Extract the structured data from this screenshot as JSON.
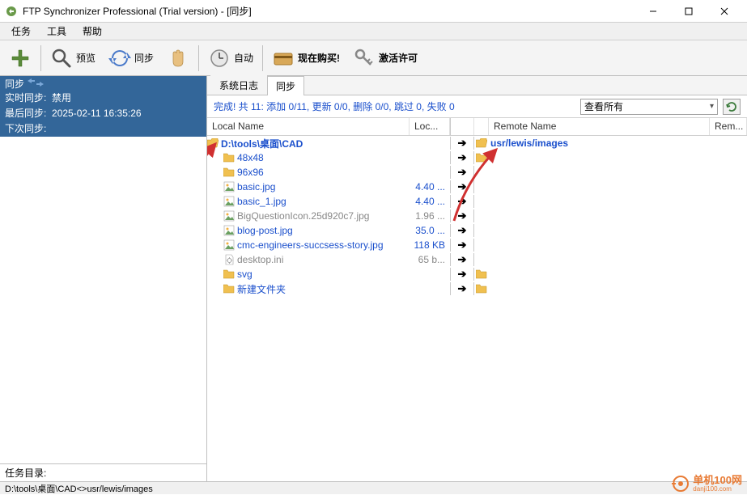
{
  "title": "FTP Synchronizer Professional (Trial version) - [同步]",
  "menu": {
    "task": "任务",
    "tools": "工具",
    "help": "帮助"
  },
  "toolbar": {
    "add": "",
    "preview": "预览",
    "sync": "同步",
    "stop": "",
    "auto": "自动",
    "buy": "现在购买!",
    "license": "激活许可"
  },
  "left": {
    "sync_title": "同步",
    "realtime_label": "实时同步:",
    "realtime_value": "禁用",
    "last_label": "最后同步:",
    "last_value": "2025-02-11 16:35:26",
    "next_label": "下次同步:",
    "next_value": "",
    "task_dir_label": "任务目录:"
  },
  "tabs": {
    "syslog": "系统日志",
    "sync": "同步"
  },
  "status": {
    "text": "完成!  共 11: 添加 0/11, 更新 0/0, 删除 0/0, 跳过 0, 失败 0",
    "filter": "查看所有"
  },
  "columns": {
    "local_name": "Local Name",
    "local_size": "Loc...",
    "remote_name": "Remote Name",
    "remote_size": "Rem..."
  },
  "local_root": "D:\\tools\\桌面\\CAD",
  "remote_root": "usr/lewis/images",
  "files": [
    {
      "name": "48x48",
      "size": "",
      "type": "folder",
      "grey": false,
      "remote_folder": true
    },
    {
      "name": "96x96",
      "size": "",
      "type": "folder",
      "grey": false,
      "remote_folder": false
    },
    {
      "name": "basic.jpg",
      "size": "4.40 ...",
      "type": "jpg",
      "grey": false,
      "remote_folder": false
    },
    {
      "name": "basic_1.jpg",
      "size": "4.40 ...",
      "type": "jpg",
      "grey": false,
      "remote_folder": false
    },
    {
      "name": "BigQuestionIcon.25d920c7.jpg",
      "size": "1.96 ...",
      "type": "jpg",
      "grey": true,
      "remote_folder": false
    },
    {
      "name": "blog-post.jpg",
      "size": "35.0 ...",
      "type": "jpg",
      "grey": false,
      "remote_folder": false
    },
    {
      "name": "cmc-engineers-succsess-story.jpg",
      "size": "118 KB",
      "type": "jpg",
      "grey": false,
      "remote_folder": false
    },
    {
      "name": "desktop.ini",
      "size": "65 b...",
      "type": "ini",
      "grey": true,
      "remote_folder": false
    },
    {
      "name": "svg",
      "size": "",
      "type": "folder",
      "grey": false,
      "remote_folder": true
    },
    {
      "name": "新建文件夹",
      "size": "",
      "type": "folder",
      "grey": false,
      "remote_folder": true
    }
  ],
  "bottom": "D:\\tools\\桌面\\CAD<>usr/lewis/images",
  "watermark": {
    "brand": "单机100网",
    "url": "danji100.com"
  }
}
